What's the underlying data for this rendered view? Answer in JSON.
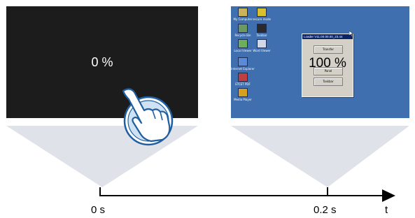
{
  "left_screen": {
    "percent": "0 %"
  },
  "right_screen": {
    "desktop_icons": [
      {
        "label": "My Computer",
        "color": "#c9b45a"
      },
      {
        "label": "secure mode",
        "color": "#d8c030"
      },
      {
        "label": "Recycle Bin",
        "color": "#6a9a60"
      },
      {
        "label": "Taskbar",
        "color": "#2a2a2a"
      },
      {
        "label": "Local Viewer",
        "color": "#6cae5a"
      },
      {
        "label": "Word Viewer",
        "color": "#d0d8e8"
      },
      {
        "label": "Internet Explorer",
        "color": "#5a8ad8"
      },
      {
        "label": "ETCET PDF",
        "color": "#c04040"
      },
      {
        "label": "Media Player",
        "color": "#d8a020"
      }
    ],
    "loader_window": {
      "title": "Loader V11.00.00.00_23.44",
      "buttons": [
        "Transfer",
        "Panel",
        "Taskbar"
      ],
      "percent": "100 %"
    }
  },
  "timeline": {
    "ticks": [
      "0 s",
      "0.2 s"
    ],
    "axis_label": "t"
  },
  "colors": {
    "projection": "#dfe3e9",
    "hand_outline": "#1f5fa0",
    "hand_fill": "#cfe2f3",
    "desktop": "#3f6fae",
    "screen": "#1c1c1c"
  }
}
